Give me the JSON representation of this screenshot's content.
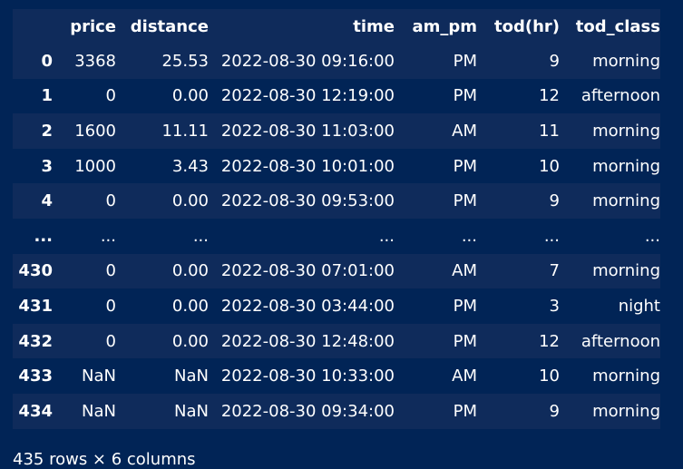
{
  "table": {
    "columns": [
      "",
      "price",
      "distance",
      "time",
      "am_pm",
      "tod(hr)",
      "tod_class"
    ],
    "rows": [
      [
        "0",
        "3368",
        "25.53",
        "2022-08-30 09:16:00",
        "PM",
        "9",
        "morning"
      ],
      [
        "1",
        "0",
        "0.00",
        "2022-08-30 12:19:00",
        "PM",
        "12",
        "afternoon"
      ],
      [
        "2",
        "1600",
        "11.11",
        "2022-08-30 11:03:00",
        "AM",
        "11",
        "morning"
      ],
      [
        "3",
        "1000",
        "3.43",
        "2022-08-30 10:01:00",
        "PM",
        "10",
        "morning"
      ],
      [
        "4",
        "0",
        "0.00",
        "2022-08-30 09:53:00",
        "PM",
        "9",
        "morning"
      ],
      [
        "...",
        "...",
        "...",
        "...",
        "...",
        "...",
        "..."
      ],
      [
        "430",
        "0",
        "0.00",
        "2022-08-30 07:01:00",
        "AM",
        "7",
        "morning"
      ],
      [
        "431",
        "0",
        "0.00",
        "2022-08-30 03:44:00",
        "PM",
        "3",
        "night"
      ],
      [
        "432",
        "0",
        "0.00",
        "2022-08-30 12:48:00",
        "PM",
        "12",
        "afternoon"
      ],
      [
        "433",
        "NaN",
        "NaN",
        "2022-08-30 10:33:00",
        "AM",
        "10",
        "morning"
      ],
      [
        "434",
        "NaN",
        "NaN",
        "2022-08-30 09:34:00",
        "PM",
        "9",
        "morning"
      ]
    ]
  },
  "footer": "435 rows × 6 columns",
  "colors": {
    "background": "#012456",
    "stripe": "#0f2b5b",
    "text": "#ffffff"
  }
}
